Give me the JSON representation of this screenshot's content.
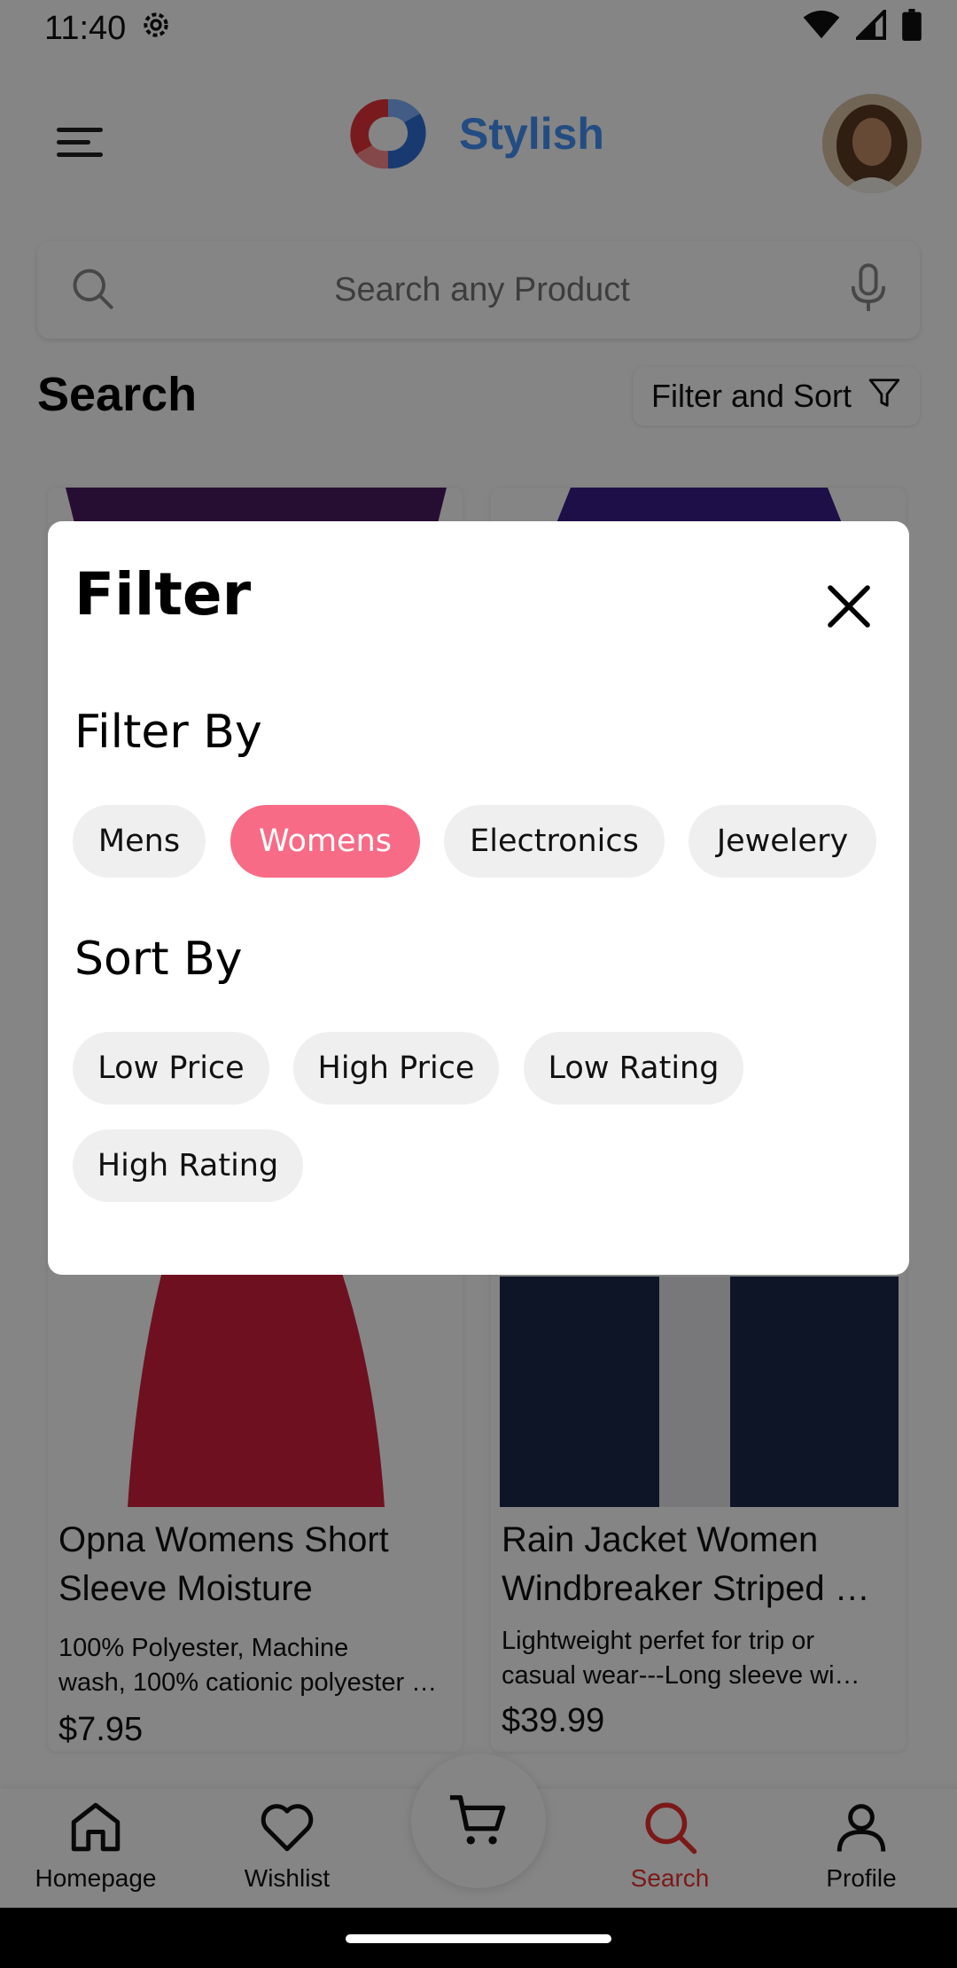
{
  "status_bar": {
    "time": "11:40"
  },
  "header": {
    "brand": "Stylish"
  },
  "search": {
    "placeholder": "Search any Product"
  },
  "page": {
    "title": "Search",
    "filter_sort_label": "Filter and Sort"
  },
  "products": [
    {
      "title_line1": "Opna Womens Short",
      "title_line2": "Sleeve Moisture",
      "desc_line1": "100% Polyester, Machine",
      "desc_line2": "wash, 100% cationic polyester …",
      "price": "$7.95"
    },
    {
      "title_line1": "Rain Jacket Women",
      "title_line2": "Windbreaker Striped …",
      "desc_line1": "Lightweight perfet for trip or",
      "desc_line2": "casual wear---Long sleeve wi…",
      "price": "$39.99"
    }
  ],
  "nav": {
    "home": "Homepage",
    "wishlist": "Wishlist",
    "search": "Search",
    "profile": "Profile",
    "active_color": "#eb3030"
  },
  "dialog": {
    "title": "Filter",
    "filter_by_title": "Filter By",
    "filter_options": [
      {
        "label": "Mens",
        "selected": false
      },
      {
        "label": "Womens",
        "selected": true
      },
      {
        "label": "Electronics",
        "selected": false
      },
      {
        "label": "Jewelery",
        "selected": false
      }
    ],
    "sort_by_title": "Sort By",
    "sort_options": [
      {
        "label": "Low Price"
      },
      {
        "label": "High Price"
      },
      {
        "label": "Low Rating"
      },
      {
        "label": "High Rating"
      }
    ],
    "selected_color": "#f76b86"
  },
  "icons": {
    "menu": "menu-icon",
    "search": "search-icon",
    "mic": "mic-icon",
    "filter": "filter-icon",
    "close": "close-icon",
    "home": "home-icon",
    "heart": "heart-icon",
    "cart": "cart-icon",
    "profile": "profile-icon"
  }
}
